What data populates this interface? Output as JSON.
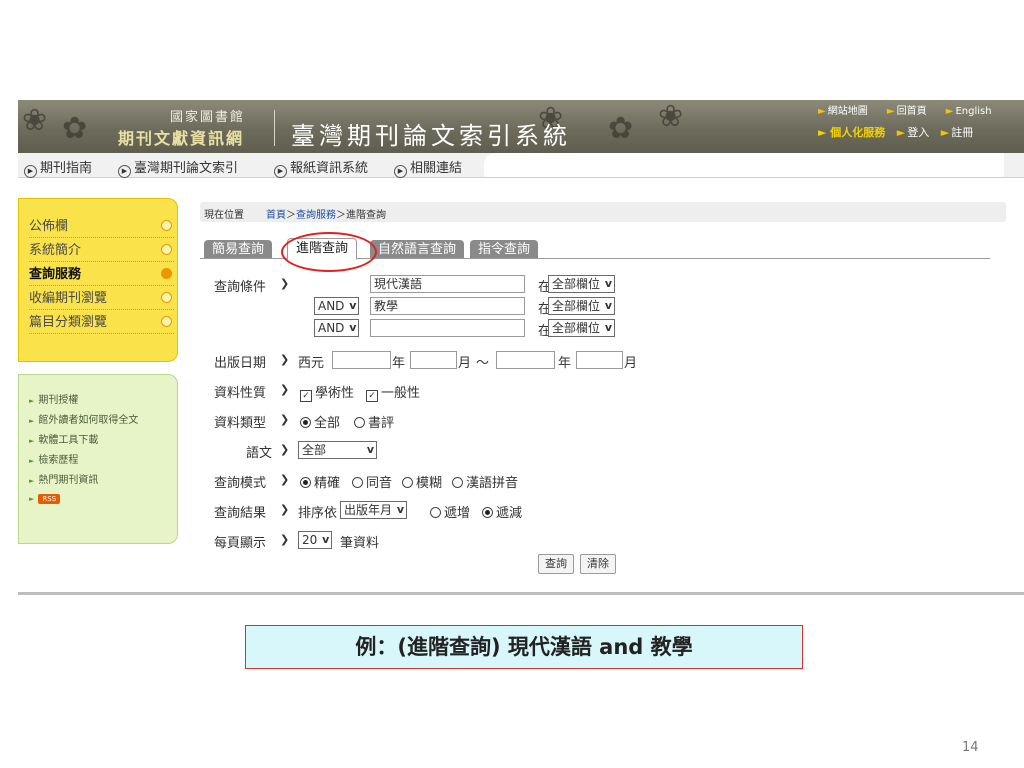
{
  "banner": {
    "library_name": "國家圖書館",
    "network_name": "期刊文獻資訊網",
    "system_title": "臺灣期刊論文索引系統",
    "top_links": [
      "網站地圖",
      "回首頁",
      "English"
    ],
    "personal_service": "個人化服務",
    "login": "登入",
    "register": "註冊"
  },
  "nav": {
    "items": [
      "期刊指南",
      "臺灣期刊論文索引",
      "報紙資訊系統",
      "相關連結"
    ]
  },
  "sidebar": {
    "menu": [
      {
        "label": "公佈欄",
        "active": false
      },
      {
        "label": "系統簡介",
        "active": false
      },
      {
        "label": "查詢服務",
        "active": true
      },
      {
        "label": "收編期刊瀏覽",
        "active": false
      },
      {
        "label": "篇目分類瀏覽",
        "active": false
      }
    ],
    "links": [
      "期刊授權",
      "館外讀者如何取得全文",
      "軟體工具下載",
      "檢索歷程",
      "熱門期刊資訊"
    ],
    "rss": "RSS"
  },
  "breadcrumb": {
    "location_label": "現在位置",
    "home": "首頁",
    "service": "查詢服務",
    "current": "進階查詢",
    "sep": "＞"
  },
  "tabs": [
    "簡易查詢",
    "進階查詢",
    "自然語言查詢",
    "指令查詢"
  ],
  "form": {
    "query_label": "查詢條件",
    "rows": [
      {
        "op": "",
        "value": "現代漢語",
        "in": "在",
        "field": "全部欄位"
      },
      {
        "op": "AND",
        "value": "教學",
        "in": "在",
        "field": "全部欄位"
      },
      {
        "op": "AND",
        "value": "",
        "in": "在",
        "field": "全部欄位"
      }
    ],
    "date_label": "出版日期",
    "era": "西元",
    "year": "年",
    "month": "月",
    "tilde": "～",
    "nature_label": "資料性質",
    "nature_opt1": "學術性",
    "nature_opt2": "一般性",
    "type_label": "資料類型",
    "type_opt1": "全部",
    "type_opt2": "書評",
    "lang_label": "語文",
    "lang_value": "全部",
    "mode_label": "查詢模式",
    "mode_opts": [
      "精確",
      "同音",
      "模糊",
      "漢語拼音"
    ],
    "result_label": "查詢結果",
    "sort_by": "排序依",
    "sort_value": "出版年月",
    "asc": "遞增",
    "desc": "遞減",
    "perpage_label": "每頁顯示",
    "perpage_value": "20",
    "perpage_unit": "筆資料",
    "search_btn": "查詢",
    "clear_btn": "清除"
  },
  "caption": "例：(進階查詢) 現代漢語 and 教學",
  "page_number": "14",
  "colors": {
    "highlight_circle": "#e02020",
    "caption_bg": "#d8f7fb",
    "menu_yellow": "#f9e24a",
    "menu_green": "#e7f4c8"
  }
}
